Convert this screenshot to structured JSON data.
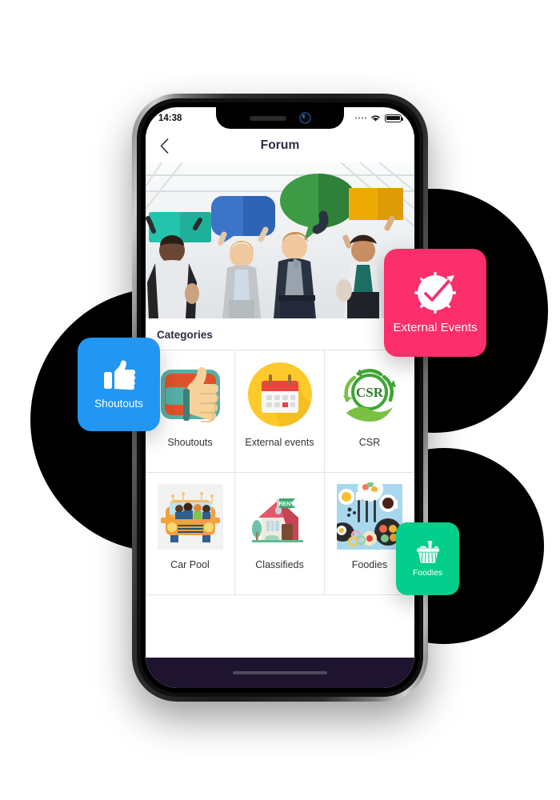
{
  "background": {
    "blobs": [
      "decorative-blob-left",
      "decorative-blob-right-top",
      "decorative-blob-right-bottom"
    ],
    "blob_color": "#000000"
  },
  "phone": {
    "status_bar": {
      "time": "14:38",
      "signal_icon": "signal-dots-icon",
      "wifi_icon": "wifi-icon",
      "battery_icon": "battery-full-icon"
    },
    "notch": {
      "speaker_icon": "speaker-grille-icon",
      "camera_icon": "front-camera-icon"
    },
    "nav": {
      "back_icon": "chevron-left-icon",
      "title": "Forum"
    },
    "hero": {
      "alt": "People holding colorful speech bubble signs",
      "bubble_colors": [
        "#1fbfae",
        "#2f6fc4",
        "#2f8f3f",
        "#eaa800"
      ]
    },
    "home_indicator": "home-indicator-bar"
  },
  "categories": {
    "heading": "Categories",
    "items": [
      {
        "label": "Shoutouts",
        "icon": "thumbs-up-icon",
        "accent": "#e0512a"
      },
      {
        "label": "External events",
        "icon": "calendar-icon",
        "accent": "#fdc92b"
      },
      {
        "label": "CSR",
        "icon": "csr-recycle-icon",
        "accent": "#3fa535"
      },
      {
        "label": "Car Pool",
        "icon": "carpool-van-icon",
        "accent": "#f29c33"
      },
      {
        "label": "Classifieds",
        "icon": "house-rent-icon",
        "accent": "#e4596a"
      },
      {
        "label": "Foodies",
        "icon": "food-flatlay-icon",
        "accent": "#a9d8ee"
      }
    ]
  },
  "floating_cards": [
    {
      "label": "Shoutouts",
      "icon": "thumbs-up-icon",
      "color": "#2196f3"
    },
    {
      "label": "External Events",
      "icon": "clock-check-icon",
      "color": "#fc2e6c"
    },
    {
      "label": "Foodies",
      "icon": "picnic-basket-icon",
      "color": "#04ce8c"
    }
  ]
}
